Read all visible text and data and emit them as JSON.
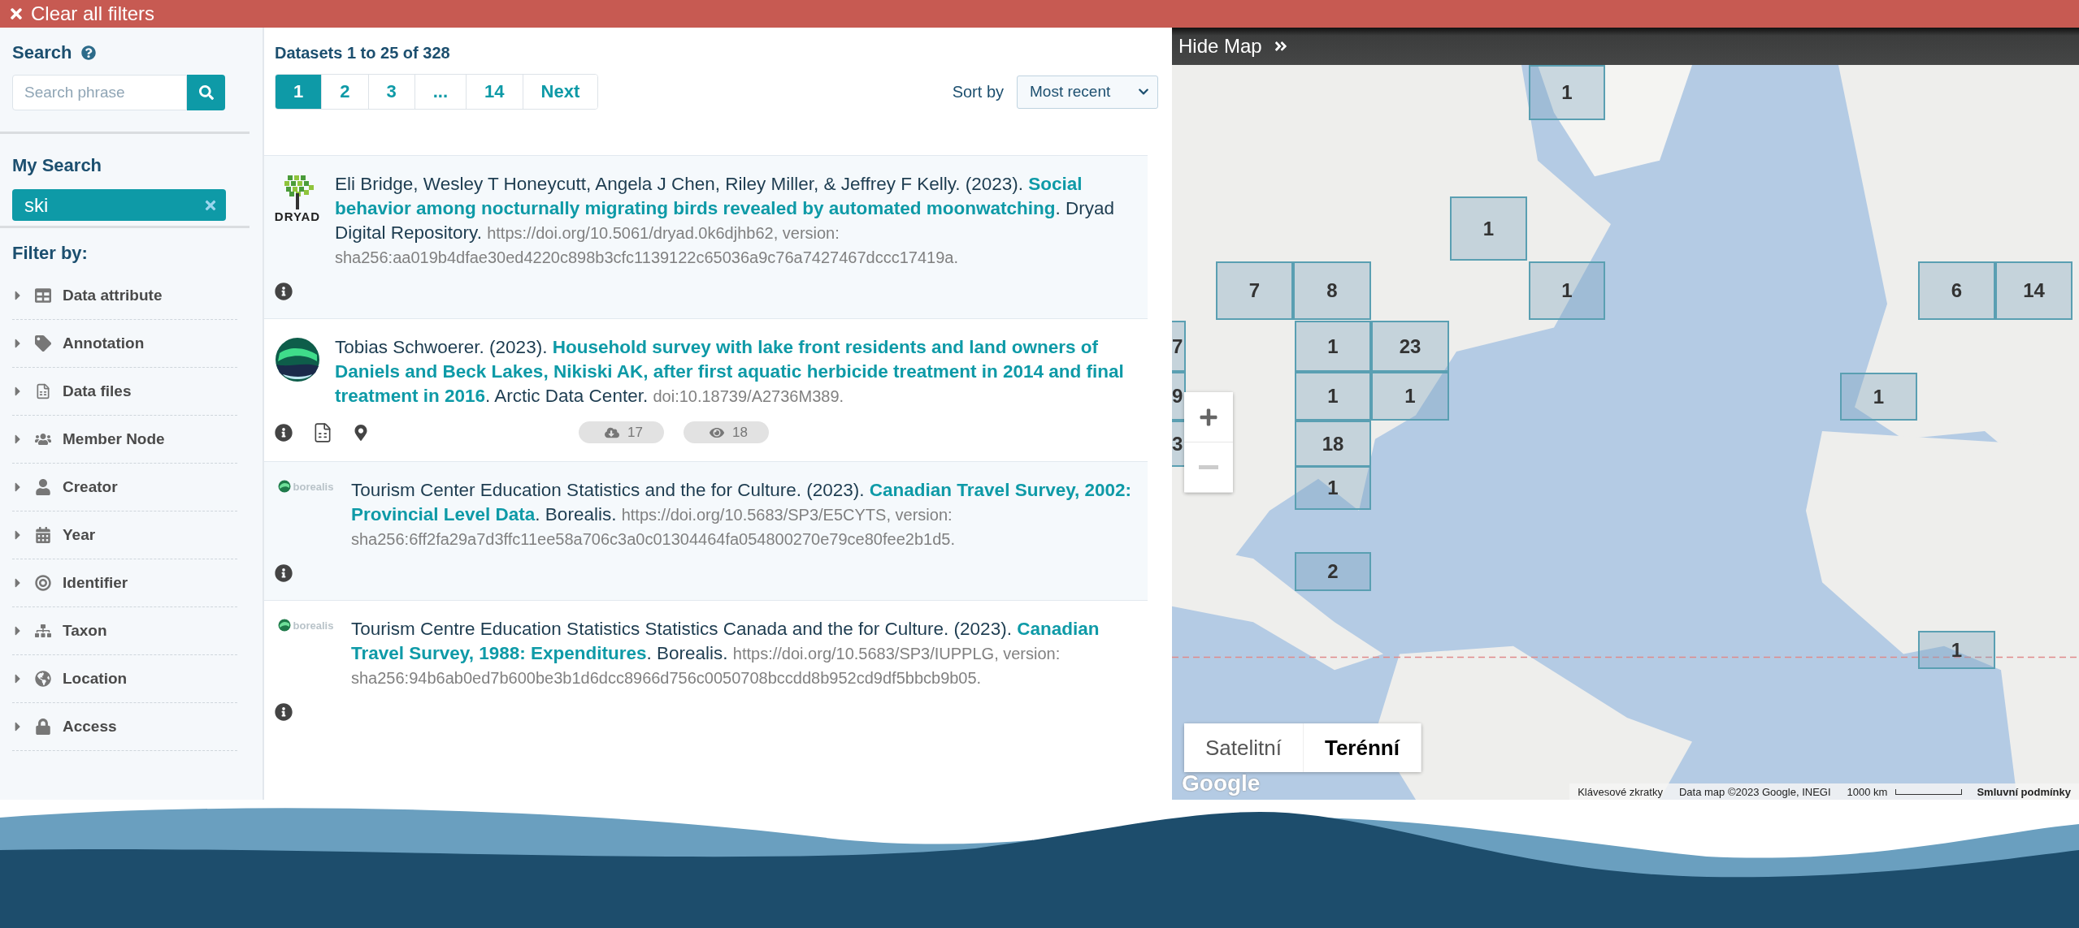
{
  "top_bar": {
    "clear_label": "Clear all filters"
  },
  "sidebar": {
    "search_title": "Search",
    "search_placeholder": "Search phrase",
    "my_search_title": "My Search",
    "search_terms": [
      "ski"
    ],
    "filter_title": "Filter by:",
    "filters": [
      {
        "label": "Data attribute",
        "expanded": false
      },
      {
        "label": "Annotation",
        "expanded": false
      },
      {
        "label": "Data files",
        "expanded": false
      },
      {
        "label": "Member Node",
        "expanded": false
      },
      {
        "label": "Creator",
        "expanded": false
      },
      {
        "label": "Year",
        "expanded": false
      },
      {
        "label": "Identifier",
        "expanded": false
      },
      {
        "label": "Taxon",
        "expanded": false
      },
      {
        "label": "Location",
        "expanded": false
      },
      {
        "label": "Access",
        "expanded": false
      }
    ]
  },
  "results": {
    "count_text": "Datasets 1 to 25 of 328",
    "pages": [
      {
        "label": "1",
        "selected": true
      },
      {
        "label": "2",
        "selected": false
      },
      {
        "label": "3",
        "selected": false
      },
      {
        "label": "...",
        "selected": false
      },
      {
        "label": "14",
        "selected": false
      },
      {
        "label": "Next",
        "selected": false
      }
    ],
    "sort_label": "Sort by",
    "sort_value": "Most recent",
    "items": [
      {
        "kind": "dryad",
        "logo_text": "DRYAD",
        "citation": "Eli Bridge, Wesley T Honeycutt, Angela J Chen, Riley Miller, & Jeffrey F Kelly. (2023). **Social behavior among nocturnally migrating birds revealed by automated moonwatching**. Dryad Digital Repository.",
        "identifier": "https://doi.org/10.5061/dryad.0k6djhb62, version: sha256:aa019b4dfae30ed4220c898b3cfc1139122c65036a9c76a7427467dccc17419a.",
        "has_data_files": false,
        "has_location": false
      },
      {
        "kind": "arctic",
        "citation": "Tobias Schwoerer. (2023). **Household survey with lake front residents and land owners of Daniels and Beck Lakes, Nikiski AK, after first aquatic herbicide treatment in 2014 and final treatment in 2016**. Arctic Data Center.",
        "identifier": "doi:10.18739/A2736M389.",
        "has_data_files": true,
        "has_location": true,
        "downloads": "17",
        "views": "18"
      },
      {
        "kind": "borealis",
        "logo_text": "borealis",
        "citation": "Tourism Center Education Statistics and the for Culture. (2023). **Canadian Travel Survey, 2002: Provincial Level Data**. Borealis.",
        "identifier": "https://doi.org/10.5683/SP3/E5CYTS, version: sha256:6ff2fa29a7d3ffc11ee58a706c3a0c01304464fa054800270e79ce80fee2b1d5.",
        "has_data_files": false,
        "has_location": false
      },
      {
        "kind": "borealis",
        "logo_text": "borealis",
        "citation": "Tourism Centre Education Statistics Statistics Canada and the for Culture. (2023). **Canadian Travel Survey, 1988: Expenditures**. Borealis.",
        "identifier": "https://doi.org/10.5683/SP3/IUPPLG, version: sha256:94b6ab0ed7b600be3b1d6dcc8966d756c0050708bccdd8b952cd9df5bbcb9b05.",
        "has_data_files": false,
        "has_location": false
      }
    ]
  },
  "map": {
    "hide_label": "Hide Map",
    "clusters": [
      "1",
      "1",
      "7",
      "8",
      "1",
      "6",
      "14",
      "7",
      "1",
      "23",
      "9",
      "1",
      "1",
      "1",
      "3",
      "18",
      "1",
      "2",
      "1"
    ],
    "map_types": [
      {
        "label": "Satelitní",
        "selected": false
      },
      {
        "label": "Terénní",
        "selected": true
      }
    ],
    "google_logo": "Google",
    "attribution": [
      "Klávesové zkratky",
      "Data map ©2023 Google, INEGI",
      "1000 km",
      "Smluvní podmínky"
    ]
  }
}
